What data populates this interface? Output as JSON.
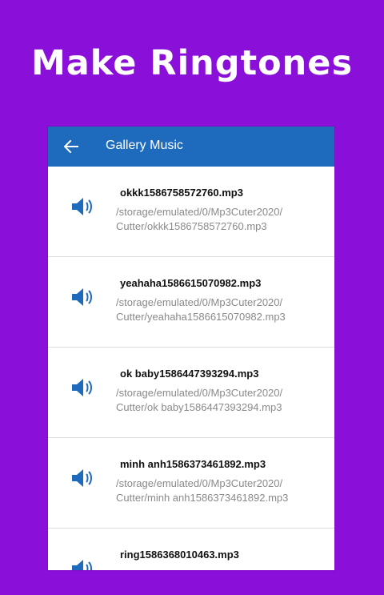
{
  "headline": "Make Ringtones",
  "appbar": {
    "title": "Gallery Music"
  },
  "colors": {
    "background": "#8a0fd9",
    "appbar": "#1e6bbd",
    "icon": "#1e6bbd"
  },
  "items": [
    {
      "title": "okkk1586758572760.mp3",
      "path_line1": "/storage/emulated/0/Mp3Cuter2020/",
      "path_line2": "Cutter/okkk1586758572760.mp3"
    },
    {
      "title": "yeahaha1586615070982.mp3",
      "path_line1": "/storage/emulated/0/Mp3Cuter2020/",
      "path_line2": "Cutter/yeahaha1586615070982.mp3"
    },
    {
      "title": "ok baby1586447393294.mp3",
      "path_line1": "/storage/emulated/0/Mp3Cuter2020/",
      "path_line2": "Cutter/ok baby1586447393294.mp3"
    },
    {
      "title": "minh anh1586373461892.mp3",
      "path_line1": "/storage/emulated/0/Mp3Cuter2020/",
      "path_line2": "Cutter/minh anh1586373461892.mp3"
    },
    {
      "title": "ring1586368010463.mp3",
      "path_line1": "",
      "path_line2": ""
    }
  ]
}
